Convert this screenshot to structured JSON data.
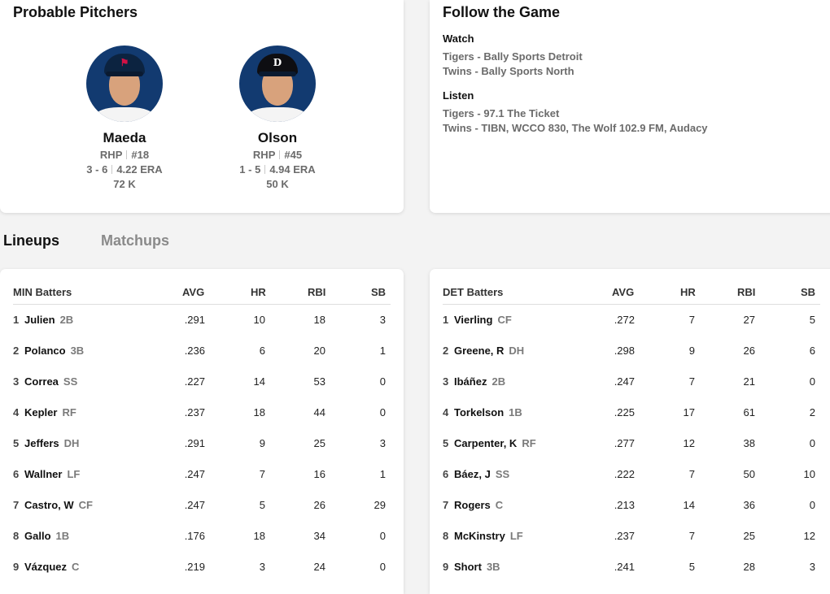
{
  "probable_pitchers": {
    "title": "Probable Pitchers",
    "pitchers": [
      {
        "name": "Maeda",
        "hand": "RHP",
        "number": "#18",
        "record": "3 - 6",
        "era": "4.22 ERA",
        "strikeouts": "72 K",
        "team_logo": "twins-logo"
      },
      {
        "name": "Olson",
        "hand": "RHP",
        "number": "#45",
        "record": "1 - 5",
        "era": "4.94 ERA",
        "strikeouts": "50 K",
        "team_logo": "tigers-logo"
      }
    ]
  },
  "follow": {
    "title": "Follow the Game",
    "watch_label": "Watch",
    "watch": [
      "Tigers - Bally Sports Detroit",
      "Twins - Bally Sports North"
    ],
    "listen_label": "Listen",
    "listen": [
      "Tigers - 97.1 The Ticket",
      "Twins - TIBN, WCCO 830, The Wolf 102.9 FM, Audacy"
    ]
  },
  "tabs": {
    "lineups": "Lineups",
    "matchups": "Matchups"
  },
  "columns": {
    "avg": "AVG",
    "hr": "HR",
    "rbi": "RBI",
    "sb": "SB"
  },
  "min": {
    "title": "MIN Batters",
    "rows": [
      {
        "order": "1",
        "name": "Julien",
        "pos": "2B",
        "avg": ".291",
        "hr": "10",
        "rbi": "18",
        "sb": "3"
      },
      {
        "order": "2",
        "name": "Polanco",
        "pos": "3B",
        "avg": ".236",
        "hr": "6",
        "rbi": "20",
        "sb": "1"
      },
      {
        "order": "3",
        "name": "Correa",
        "pos": "SS",
        "avg": ".227",
        "hr": "14",
        "rbi": "53",
        "sb": "0"
      },
      {
        "order": "4",
        "name": "Kepler",
        "pos": "RF",
        "avg": ".237",
        "hr": "18",
        "rbi": "44",
        "sb": "0"
      },
      {
        "order": "5",
        "name": "Jeffers",
        "pos": "DH",
        "avg": ".291",
        "hr": "9",
        "rbi": "25",
        "sb": "3"
      },
      {
        "order": "6",
        "name": "Wallner",
        "pos": "LF",
        "avg": ".247",
        "hr": "7",
        "rbi": "16",
        "sb": "1"
      },
      {
        "order": "7",
        "name": "Castro, W",
        "pos": "CF",
        "avg": ".247",
        "hr": "5",
        "rbi": "26",
        "sb": "29"
      },
      {
        "order": "8",
        "name": "Gallo",
        "pos": "1B",
        "avg": ".176",
        "hr": "18",
        "rbi": "34",
        "sb": "0"
      },
      {
        "order": "9",
        "name": "Vázquez",
        "pos": "C",
        "avg": ".219",
        "hr": "3",
        "rbi": "24",
        "sb": "0"
      }
    ]
  },
  "det": {
    "title": "DET Batters",
    "rows": [
      {
        "order": "1",
        "name": "Vierling",
        "pos": "CF",
        "avg": ".272",
        "hr": "7",
        "rbi": "27",
        "sb": "5"
      },
      {
        "order": "2",
        "name": "Greene, R",
        "pos": "DH",
        "avg": ".298",
        "hr": "9",
        "rbi": "26",
        "sb": "6"
      },
      {
        "order": "3",
        "name": "Ibáñez",
        "pos": "2B",
        "avg": ".247",
        "hr": "7",
        "rbi": "21",
        "sb": "0"
      },
      {
        "order": "4",
        "name": "Torkelson",
        "pos": "1B",
        "avg": ".225",
        "hr": "17",
        "rbi": "61",
        "sb": "2"
      },
      {
        "order": "5",
        "name": "Carpenter, K",
        "pos": "RF",
        "avg": ".277",
        "hr": "12",
        "rbi": "38",
        "sb": "0"
      },
      {
        "order": "6",
        "name": "Báez, J",
        "pos": "SS",
        "avg": ".222",
        "hr": "7",
        "rbi": "50",
        "sb": "10"
      },
      {
        "order": "7",
        "name": "Rogers",
        "pos": "C",
        "avg": ".213",
        "hr": "14",
        "rbi": "36",
        "sb": "0"
      },
      {
        "order": "8",
        "name": "McKinstry",
        "pos": "LF",
        "avg": ".237",
        "hr": "7",
        "rbi": "25",
        "sb": "12"
      },
      {
        "order": "9",
        "name": "Short",
        "pos": "3B",
        "avg": ".241",
        "hr": "5",
        "rbi": "28",
        "sb": "3"
      }
    ]
  }
}
